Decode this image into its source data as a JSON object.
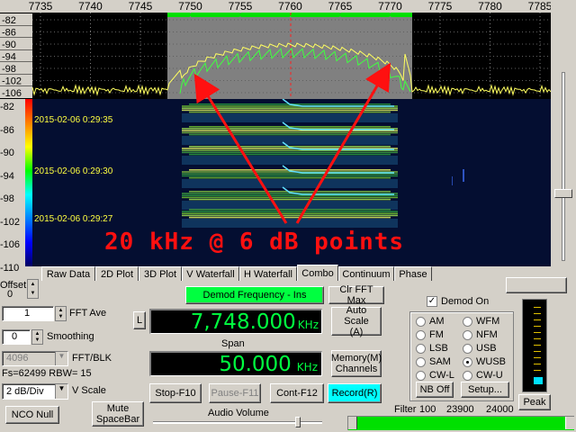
{
  "spectrum": {
    "freq_ticks": [
      "7735",
      "7740",
      "7745",
      "7750",
      "7755",
      "7760",
      "7765",
      "7770",
      "7775",
      "7780",
      "7785"
    ],
    "db_ticks": [
      "-82",
      "-86",
      "-90",
      "-94",
      "-98",
      "-102",
      "-106"
    ]
  },
  "waterfall": {
    "db_ticks": [
      "-82",
      "-86",
      "-90",
      "-94",
      "-98",
      "-102",
      "-106",
      "-110"
    ],
    "timestamps": [
      "2015-02-06 0:29:35",
      "2015-02-06 0:29:30",
      "2015-02-06 0:29:27"
    ],
    "annotation": "20 kHz @ 6 dB points",
    "annotation_color": "#ff1010"
  },
  "tabs": [
    "Raw Data",
    "2D Plot",
    "3D Plot",
    "V Waterfall",
    "H Waterfall",
    "Combo",
    "Continuum",
    "Phase"
  ],
  "active_tab": "Combo",
  "left_panel": {
    "offset_label": "Offset",
    "offset_value": "0",
    "fft_ave_value": "1",
    "fft_ave_label": "FFT Ave",
    "smoothing_value": "0",
    "smoothing_label": "Smoothing",
    "fft_blk_value": "4096",
    "fft_blk_label": "FFT/BLK",
    "fs_text": "Fs=62499 RBW= 15",
    "vscale_value": "2 dB/Div",
    "vscale_label": "V Scale",
    "nco_null": "NCO Null"
  },
  "center_panel": {
    "demod_freq_button": "Demod Frequency - Ins",
    "clr_fft_max": "Clr FFT Max",
    "l_button": "L",
    "frequency_value": "7,748.000",
    "frequency_unit": "KHz",
    "auto_scale": "Auto Scale (A)",
    "span_label": "Span",
    "span_value": "50.000",
    "span_unit": "KHz",
    "memory_channels": "Memory(M) Channels",
    "mute_button": "Mute SpaceBar",
    "stop_button": "Stop-F10",
    "pause_button": "Pause-F11",
    "cont_button": "Cont-F12",
    "record_button": "Record(R)",
    "audio_volume_label": "Audio Volume"
  },
  "right_panel": {
    "demod_on_label": "Demod On",
    "demod_on_checked": true,
    "modes_left": [
      "AM",
      "FM",
      "LSB",
      "SAM",
      "CW-L"
    ],
    "modes_right": [
      "WFM",
      "NFM",
      "USB",
      "WUSB",
      "CW-U"
    ],
    "selected_mode": "WUSB",
    "nb_off": "NB Off",
    "setup": "Setup...",
    "peak": "Peak",
    "filter_label": "Filter",
    "filter_values": [
      "100",
      "23900",
      "24000"
    ]
  },
  "colors": {
    "lcd_green": "#00ff40",
    "record_cyan": "#00ffff",
    "demod_green": "#00ff40",
    "spectrum_trace": "#ffff60",
    "max_hold_trace": "#40ff40",
    "passband_bar": "#00e000"
  }
}
